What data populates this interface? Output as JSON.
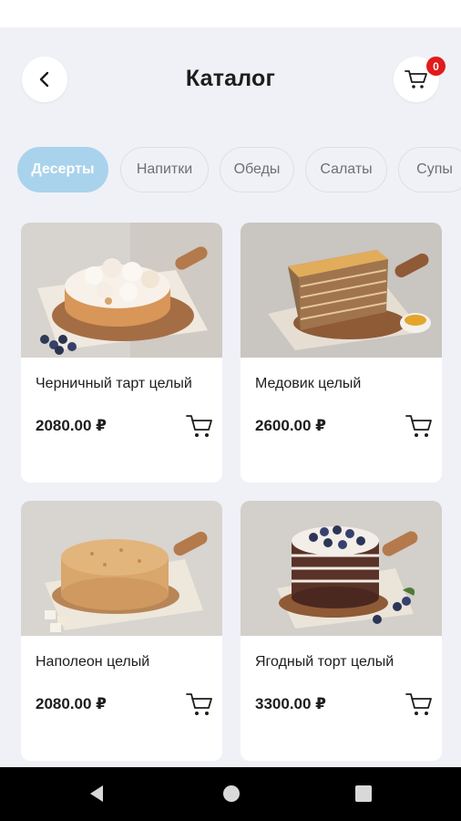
{
  "header": {
    "title": "Каталог",
    "cart_count": "0"
  },
  "categories": [
    {
      "label": "Десерты",
      "active": true
    },
    {
      "label": "Напитки",
      "active": false
    },
    {
      "label": "Обеды",
      "active": false
    },
    {
      "label": "Салаты",
      "active": false
    },
    {
      "label": "Супы",
      "active": false
    }
  ],
  "products": [
    {
      "name": "Черничный тарт целый",
      "price": "2080.00 ₽",
      "image": "blueberry-meringue-tart"
    },
    {
      "name": "Медовик целый",
      "price": "2600.00 ₽",
      "image": "honey-cake-slice"
    },
    {
      "name": "Наполеон целый",
      "price": "2080.00 ₽",
      "image": "napoleon-cake"
    },
    {
      "name": "Ягодный торт целый",
      "price": "3300.00 ₽",
      "image": "berry-layer-cake"
    }
  ],
  "icons": {
    "back": "chevron-left-icon",
    "cart": "cart-icon",
    "nav_back": "triangle-back-icon",
    "nav_home": "circle-home-icon",
    "nav_recents": "square-recents-icon"
  },
  "colors": {
    "background": "#f0f1f7",
    "accent_chip": "#a9d3ec",
    "badge": "#e21b1b"
  }
}
